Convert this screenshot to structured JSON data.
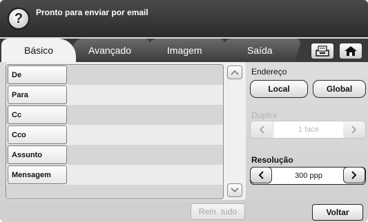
{
  "header": {
    "help_symbol": "?",
    "status": "Pronto para enviar por email"
  },
  "tabs": [
    {
      "label": "Básico",
      "active": true
    },
    {
      "label": "Avançado",
      "active": false
    },
    {
      "label": "Imagem",
      "active": false
    },
    {
      "label": "Saída",
      "active": false
    }
  ],
  "toolbar": {
    "icons": [
      "job-status-icon",
      "home-icon"
    ]
  },
  "fields": [
    {
      "label": "De",
      "value": ""
    },
    {
      "label": "Para",
      "value": ""
    },
    {
      "label": "Cc",
      "value": ""
    },
    {
      "label": "Cco",
      "value": ""
    },
    {
      "label": "Assunto",
      "value": ""
    },
    {
      "label": "Mensagem",
      "value": ""
    }
  ],
  "actions": {
    "clear_all": "Rem. tudo",
    "back": "Voltar"
  },
  "address": {
    "label": "Endereço",
    "local": "Local",
    "global": "Global"
  },
  "duplex": {
    "label": "Duplex",
    "value": "1 face",
    "enabled": false
  },
  "resolution": {
    "label": "Resolução",
    "value": "300 ppp",
    "enabled": true
  }
}
